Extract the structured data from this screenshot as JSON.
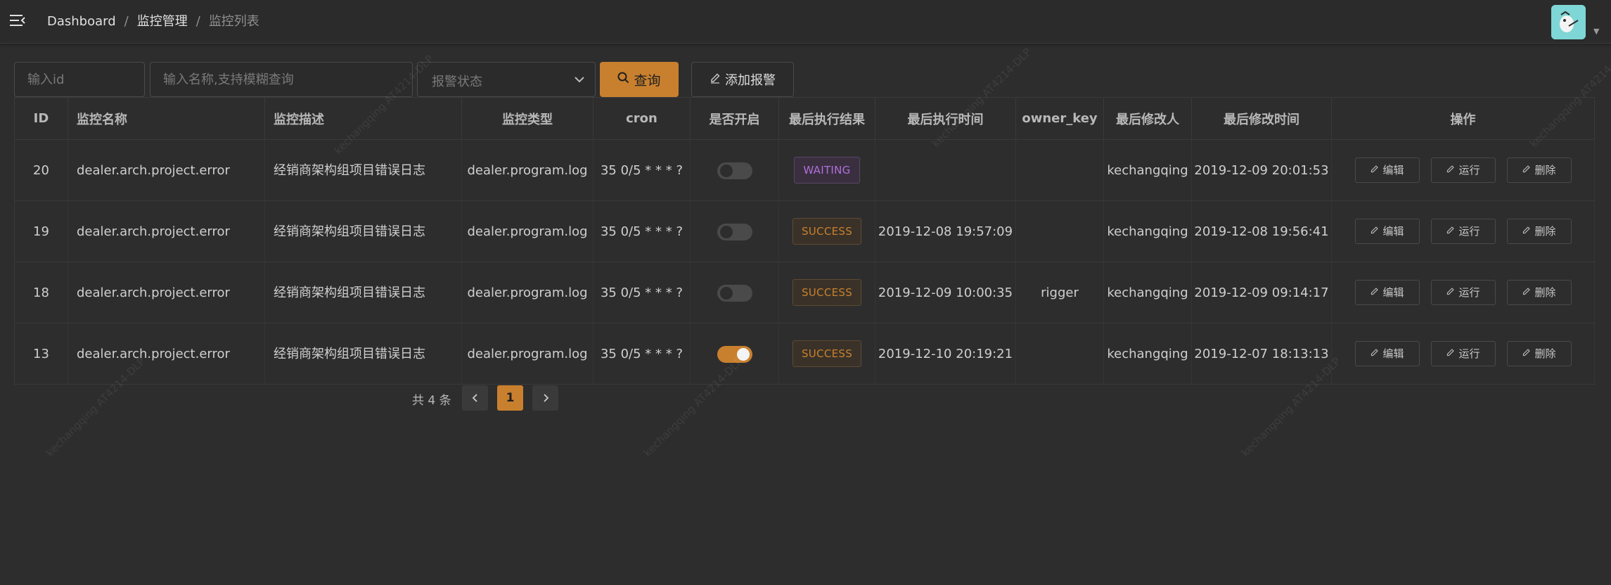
{
  "header": {
    "breadcrumb": [
      {
        "label": "Dashboard"
      },
      {
        "label": "监控管理"
      },
      {
        "label": "监控列表"
      }
    ],
    "separator": "/"
  },
  "search": {
    "id_placeholder": "输入id",
    "name_placeholder": "输入名称,支持模糊查询",
    "status_placeholder": "报警状态",
    "query_label": "查询",
    "add_label": "添加报警"
  },
  "table": {
    "columns": {
      "id": "ID",
      "name": "监控名称",
      "desc": "监控描述",
      "type": "监控类型",
      "cron": "cron",
      "enabled": "是否开启",
      "last_result": "最后执行结果",
      "last_time": "最后执行时间",
      "owner_key": "owner_key",
      "modifier": "最后修改人",
      "modified_time": "最后修改时间",
      "ops": "操作"
    },
    "action_labels": {
      "edit": "编辑",
      "run": "运行",
      "delete": "删除"
    },
    "rows": [
      {
        "id": "20",
        "name": "dealer.arch.project.error",
        "desc": "经销商架构组项目错误日志",
        "type": "dealer.program.log",
        "cron": "35 0/5 * * * ?",
        "enabled": false,
        "result": "WAITING",
        "last_time": "",
        "owner_key": "",
        "modifier": "kechangqing",
        "modified_time": "2019-12-09 20:01:53"
      },
      {
        "id": "19",
        "name": "dealer.arch.project.error",
        "desc": "经销商架构组项目错误日志",
        "type": "dealer.program.log",
        "cron": "35 0/5 * * * ?",
        "enabled": false,
        "result": "SUCCESS",
        "last_time": "2019-12-08 19:57:09",
        "owner_key": "",
        "modifier": "kechangqing",
        "modified_time": "2019-12-08 19:56:41"
      },
      {
        "id": "18",
        "name": "dealer.arch.project.error",
        "desc": "经销商架构组项目错误日志",
        "type": "dealer.program.log",
        "cron": "35 0/5 * * * ?",
        "enabled": false,
        "result": "SUCCESS",
        "last_time": "2019-12-09 10:00:35",
        "owner_key": "rigger",
        "modifier": "kechangqing",
        "modified_time": "2019-12-09 09:14:17"
      },
      {
        "id": "13",
        "name": "dealer.arch.project.error",
        "desc": "经销商架构组项目错误日志",
        "type": "dealer.program.log",
        "cron": "35 0/5 * * * ?",
        "enabled": true,
        "result": "SUCCESS",
        "last_time": "2019-12-10 20:19:21",
        "owner_key": "",
        "modifier": "kechangqing",
        "modified_time": "2019-12-07 18:13:13"
      }
    ]
  },
  "pagination": {
    "total_text": "共 4 条",
    "current_page": "1"
  },
  "watermark": {
    "text": "kechangqing   AT4214-DLP"
  },
  "colors": {
    "accent": "#c9802e",
    "waiting": "#b06fd9",
    "background": "#2d2d2d"
  }
}
